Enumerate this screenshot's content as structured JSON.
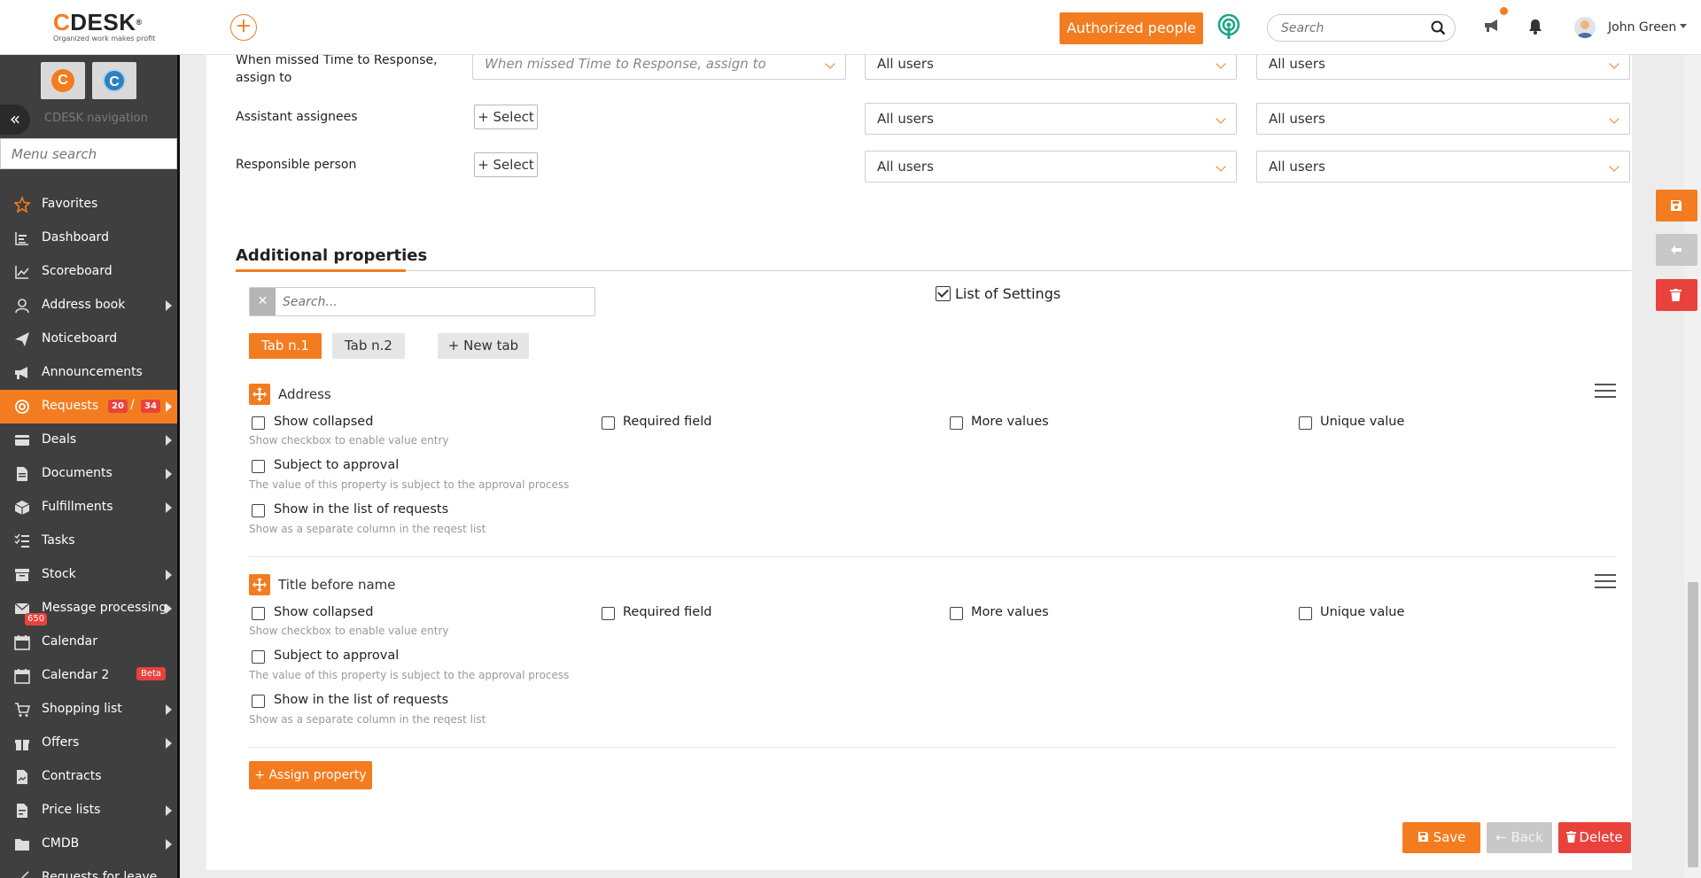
{
  "header": {
    "logo_text": "CDESK",
    "logo_reg": "®",
    "logo_tagline": "Organized work makes profit",
    "authorized_label": "Authorized people",
    "search_placeholder": "Search",
    "user_name": "John Green"
  },
  "sidebar": {
    "nav_label": "CDESK navigation",
    "menu_search_placeholder": "Menu search",
    "items": [
      {
        "label": "Favorites",
        "icon": "star-icon"
      },
      {
        "label": "Dashboard",
        "icon": "dashboard-icon"
      },
      {
        "label": "Scoreboard",
        "icon": "chart-line-icon"
      },
      {
        "label": "Address book",
        "icon": "user-icon"
      },
      {
        "label": "Noticeboard",
        "icon": "paper-plane-icon"
      },
      {
        "label": "Announcements",
        "icon": "megaphone-icon"
      },
      {
        "label": "Requests",
        "icon": "requests-icon",
        "badge_a": "20",
        "badge_sep": "/",
        "badge_b": "34"
      },
      {
        "label": "Deals",
        "icon": "deals-icon"
      },
      {
        "label": "Documents",
        "icon": "document-icon"
      },
      {
        "label": "Fulfillments",
        "icon": "box-icon"
      },
      {
        "label": "Tasks",
        "icon": "tasks-icon"
      },
      {
        "label": "Stock",
        "icon": "archive-icon"
      },
      {
        "label": "Message processing",
        "icon": "envelope-icon",
        "badge": "650"
      },
      {
        "label": "Calendar",
        "icon": "calendar-icon"
      },
      {
        "label": "Calendar 2",
        "icon": "calendar-icon",
        "badge": "Beta"
      },
      {
        "label": "Shopping list",
        "icon": "cart-icon"
      },
      {
        "label": "Offers",
        "icon": "gift-icon"
      },
      {
        "label": "Contracts",
        "icon": "contract-icon"
      },
      {
        "label": "Price lists",
        "icon": "price-list-icon"
      },
      {
        "label": "CMDB",
        "icon": "folder-icon"
      },
      {
        "label": "Requests for leave",
        "icon": "leave-icon"
      }
    ]
  },
  "assign_rows": [
    {
      "label": "When missed Time to Response, assign to",
      "placeholder": "When missed Time to Response, assign to",
      "col2": "All users",
      "col3": "All users"
    },
    {
      "label": "Assistant assignees",
      "button": "Select",
      "col2": "All users",
      "col3": "All users"
    },
    {
      "label": "Responsible person",
      "button": "Select",
      "col2": "All users",
      "col3": "All users"
    }
  ],
  "additional": {
    "title": "Additional properties",
    "search_placeholder": "Search...",
    "list_of_settings": "List of Settings",
    "tabs": [
      "Tab n.1",
      "Tab n.2"
    ],
    "new_tab": "New tab",
    "properties": [
      {
        "name": "Address",
        "show_collapsed": "Show collapsed",
        "show_collapsed_hint": "Show checkbox to enable value entry",
        "required": "Required field",
        "more_values": "More values",
        "unique": "Unique value",
        "approval": "Subject to approval",
        "approval_hint": "The value of this property is subject to the approval process",
        "list_show": "Show in the list of requests",
        "list_hint": "Show as a separate column in the reqest list"
      },
      {
        "name": "Title before name",
        "show_collapsed": "Show collapsed",
        "show_collapsed_hint": "Show checkbox to enable value entry",
        "required": "Required field",
        "more_values": "More values",
        "unique": "Unique value",
        "approval": "Subject to approval",
        "approval_hint": "The value of this property is subject to the approval process",
        "list_show": "Show in the list of requests",
        "list_hint": "Show as a separate column in the reqest list"
      }
    ],
    "assign_property": "Assign property"
  },
  "actions": {
    "save": "Save",
    "back": "Back",
    "delete": "Delete"
  },
  "colors": {
    "accent": "#f47c20",
    "danger": "#e9423d",
    "sidebar_bg": "#3f3f3f"
  }
}
